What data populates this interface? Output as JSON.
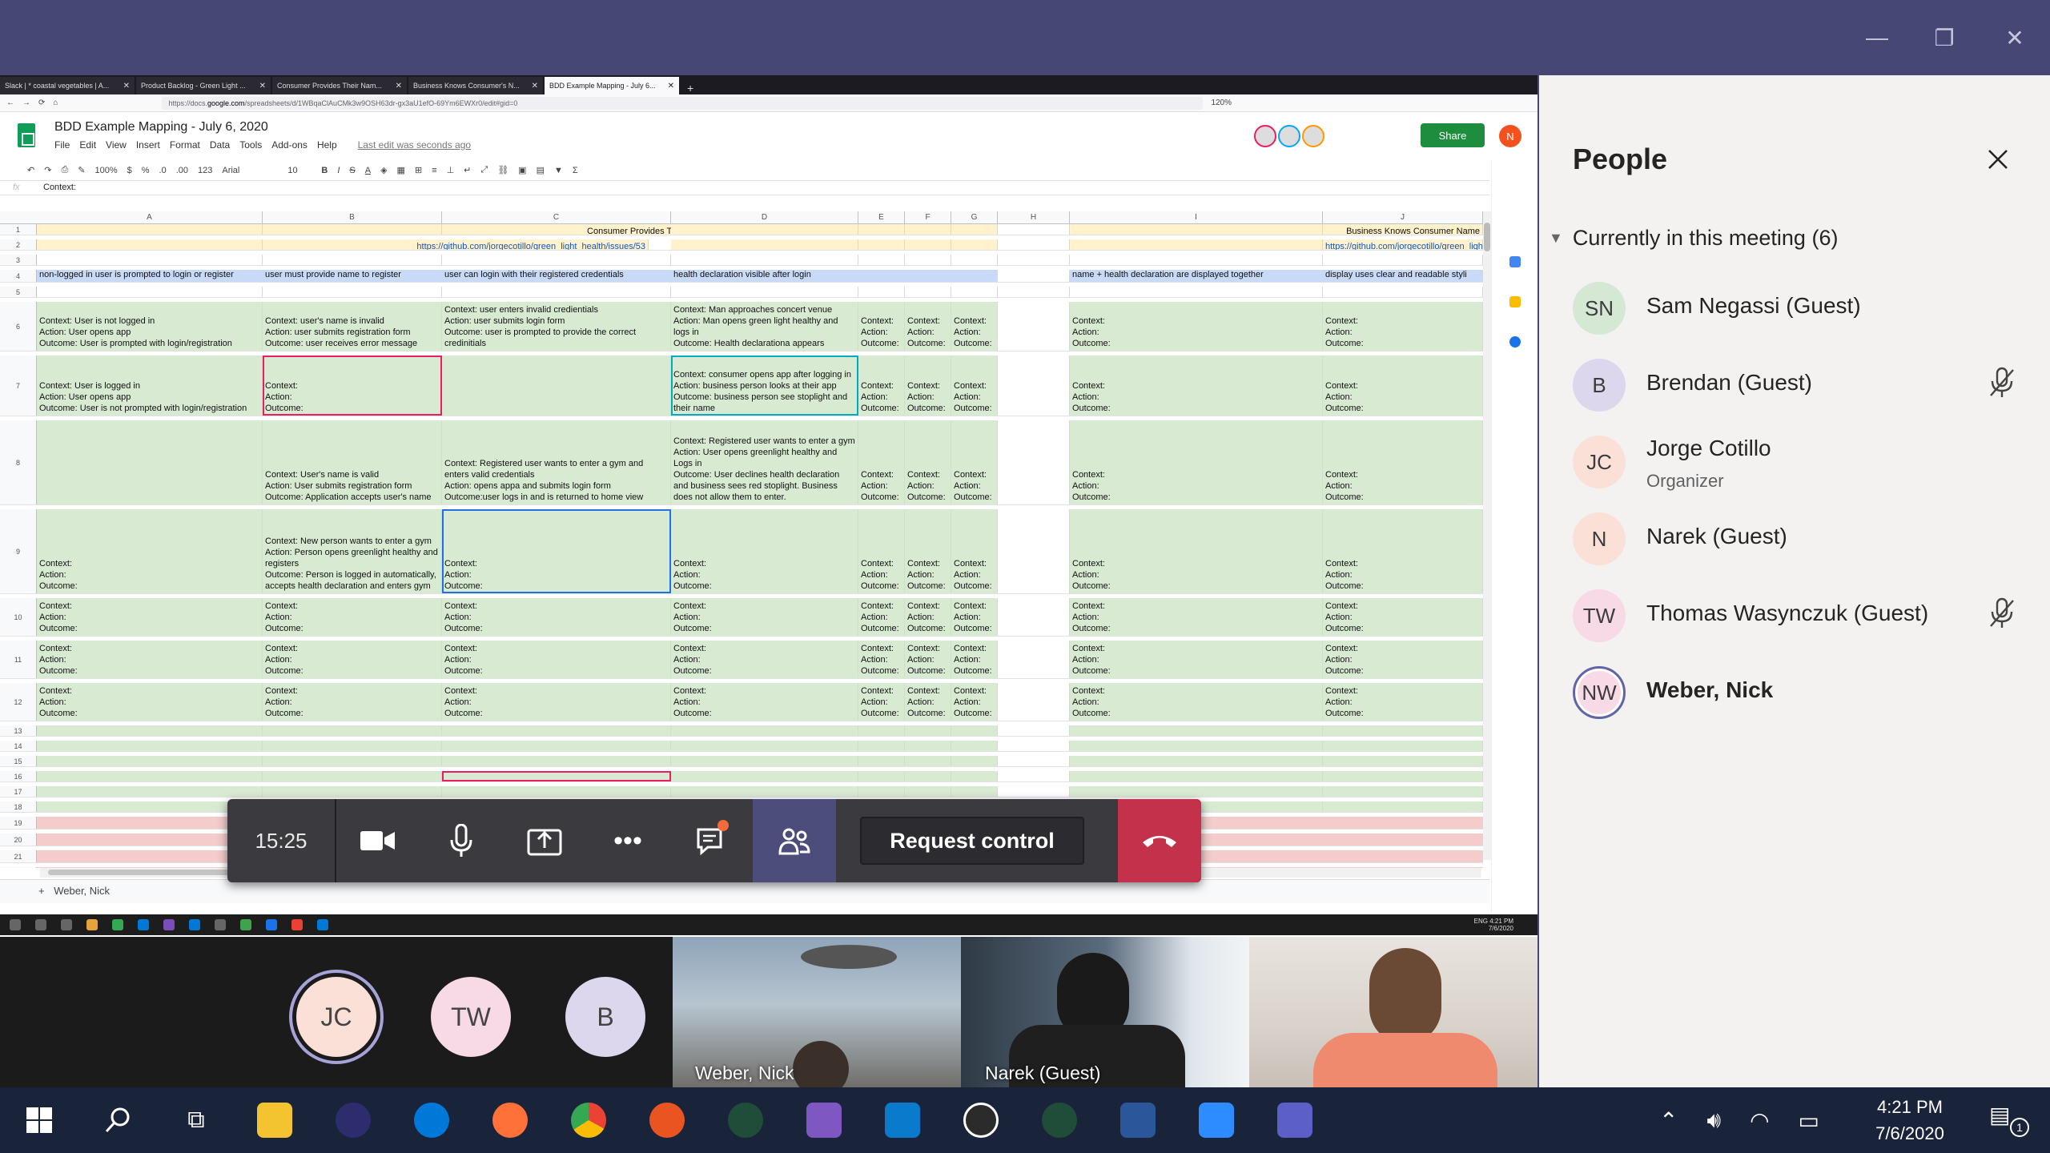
{
  "window": {
    "minimize": "—",
    "maximize": "❐",
    "close": "✕"
  },
  "browser": {
    "tabs": [
      "Slack | * coastal vegetables | A...",
      "Product Backlog - Green Light ...",
      "Consumer Provides Their Nam...",
      "Business Knows Consumer's N...",
      "BDD Example Mapping - July 6..."
    ],
    "url_prefix": "https://docs.",
    "url_domain": "google.com",
    "url_rest": "/spreadsheets/d/1WBqaClAuCMk3w9OSH63dr-gx3aU1efO-69Ym6EWXr0/edit#gid=0",
    "zoom": "120%"
  },
  "sheet": {
    "title": "BDD Example Mapping - July 6, 2020",
    "menu": [
      "File",
      "Edit",
      "View",
      "Insert",
      "Format",
      "Data",
      "Tools",
      "Add-ons",
      "Help"
    ],
    "last_edit": "Last edit was seconds ago",
    "share": "Share",
    "user_initial": "N",
    "toolbar": {
      "zoom": "100%",
      "currency": "$",
      "percent": "%",
      "dec1": ".0",
      "dec2": ".00",
      "format": "123",
      "font": "Arial",
      "size": "10"
    },
    "formula_label": "fx",
    "formula": "Context:",
    "columns": [
      "A",
      "B",
      "C",
      "D",
      "E",
      "F",
      "G",
      "H",
      "I",
      "J"
    ],
    "rows": {
      "r1_C": "Consumer Provides Their Name",
      "r1_J": "Business Knows Consumer Name",
      "r2_C": "https://github.com/jorgecotillo/green_light_health/issues/53",
      "r2_J": "https://github.com/jorgecotillo/green_light_health",
      "r4": [
        "non-logged in user is prompted to login or register",
        "user must provide name to register",
        "user can login with their registered credentials",
        "health declaration visible after login",
        "",
        "",
        "",
        "",
        "name + health declaration are displayed together",
        "display uses clear and readable styli"
      ],
      "r6": [
        "Context: User is not logged in\nAction: User opens app\nOutcome: User is prompted with login/registration",
        "Context: user's name is invalid\nAction: user submits registration form\nOutcome: user receives error message",
        "Context: user enters invalid credientials\nAction: user submits login form\nOutcome: user is prompted to provide the correct credinitials",
        "Context: Man approaches concert venue\nAction: Man opens green light healthy and logs in\nOutcome: Health declarationa appears",
        "Context:\nAction:\nOutcome:",
        "Context:\nAction:\nOutcome:",
        "Context:\nAction:\nOutcome:",
        "",
        "Context:\nAction:\nOutcome:",
        "Context:\nAction:\nOutcome:"
      ],
      "r7": [
        "Context: User is logged in\nAction: User opens app\nOutcome: User is not prompted with login/registration",
        "Context:\nAction:\nOutcome:",
        "",
        "Context: consumer opens app after logging in\nAction: business person looks at their app\nOutcome: business person see stoplight and their name",
        "Context:\nAction:\nOutcome:",
        "Context:\nAction:\nOutcome:",
        "Context:\nAction:\nOutcome:",
        "",
        "Context:\nAction:\nOutcome:",
        "Context:\nAction:\nOutcome:"
      ],
      "r8": [
        "",
        "Context: User's name is valid\nAction: User submits registration form\nOutcome: Application accepts user's name",
        "Context: Registered user wants to enter a gym and enters valid credentials\nAction: opens appa and submits login form\nOutcome:user logs in and is returned to home view",
        "Context: Registered user wants to enter a gym\nAction: User opens greenlight healthy and Logs in\nOutcome: User declines health declaration and business sees red stoplight. Business does not allow them to enter.",
        "Context:\nAction:\nOutcome:",
        "Context:\nAction:\nOutcome:",
        "Context:\nAction:\nOutcome:",
        "",
        "Context:\nAction:\nOutcome:",
        "Context:\nAction:\nOutcome:"
      ],
      "r9": [
        "Context:\nAction:\nOutcome:",
        "Context: New person wants to enter a gym\nAction: Person opens greenlight healthy and registers\nOutcome: Person is logged in automatically, accepts health declaration and enters gym",
        "Context:\nAction:\nOutcome:",
        "Context:\nAction:\nOutcome:",
        "Context:\nAction:\nOutcome:",
        "Context:\nAction:\nOutcome:",
        "Context:\nAction:\nOutcome:",
        "",
        "Context:\nAction:\nOutcome:",
        "Context:\nAction:\nOutcome:"
      ],
      "generic": "Context:\nAction:\nOutcome:"
    },
    "sheet_tab": "Weber, Nick",
    "add_sheet": "+"
  },
  "call": {
    "time": "15:25",
    "request_control": "Request control"
  },
  "people": {
    "title": "People",
    "group": "Currently in this meeting (6)",
    "list": [
      {
        "initials": "SN",
        "name": "Sam Negassi (Guest)",
        "role": "",
        "bg": "#d4e8d4",
        "muted": false
      },
      {
        "initials": "B",
        "name": "Brendan (Guest)",
        "role": "",
        "bg": "#dcd7ec",
        "muted": true
      },
      {
        "initials": "JC",
        "name": "Jorge Cotillo",
        "role": "Organizer",
        "bg": "#fbe0d8",
        "muted": false
      },
      {
        "initials": "N",
        "name": "Narek (Guest)",
        "role": "",
        "bg": "#fbe0d8",
        "muted": false
      },
      {
        "initials": "TW",
        "name": "Thomas Wasynczuk (Guest)",
        "role": "",
        "bg": "#f8d9e6",
        "muted": true
      },
      {
        "initials": "NW",
        "name": "Weber, Nick",
        "role": "",
        "bg": "#f8d9e6",
        "muted": false
      }
    ]
  },
  "strip": {
    "avatars": [
      {
        "initials": "JC",
        "bg": "#fbe0d8"
      },
      {
        "initials": "TW",
        "bg": "#f8d9e6"
      },
      {
        "initials": "B",
        "bg": "#dcd7ec"
      }
    ],
    "videos": [
      "Weber, Nick",
      "Narek (Guest)",
      ""
    ]
  },
  "inner_clock": {
    "time": "4:21 PM",
    "date": "7/6/2020",
    "lang": "ENG"
  },
  "taskbar": {
    "time": "4:21 PM",
    "date": "7/6/2020",
    "notif": "1"
  }
}
